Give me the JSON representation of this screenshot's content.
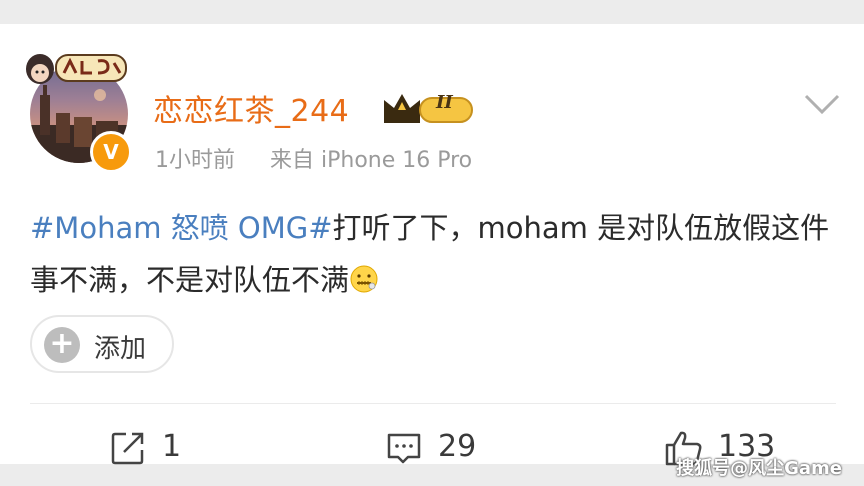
{
  "post": {
    "username": "恋恋红茶_244",
    "vip_level": "II",
    "time": "1小时前",
    "source": "来自 iPhone 16 Pro",
    "hashtag": "#Moham 怒喷 OMG#",
    "text": "打听了下，moham 是对队伍放假这件事不满，不是对队伍不满",
    "emoji": "zipper-mouth-emoji"
  },
  "add_button": {
    "label": "添加"
  },
  "actions": {
    "repost_count": "1",
    "comment_count": "29",
    "like_count": "133"
  },
  "watermark": "搜狐号@风尘Game",
  "colors": {
    "username": "#e86c17",
    "hashtag": "#4a7fbf",
    "verified_badge": "#f79a0c",
    "background": "#ececec"
  },
  "icons": [
    "more-chevron-icon",
    "verified-icon",
    "vip-crown-icon",
    "plus-icon",
    "repost-icon",
    "comment-icon",
    "like-icon"
  ]
}
